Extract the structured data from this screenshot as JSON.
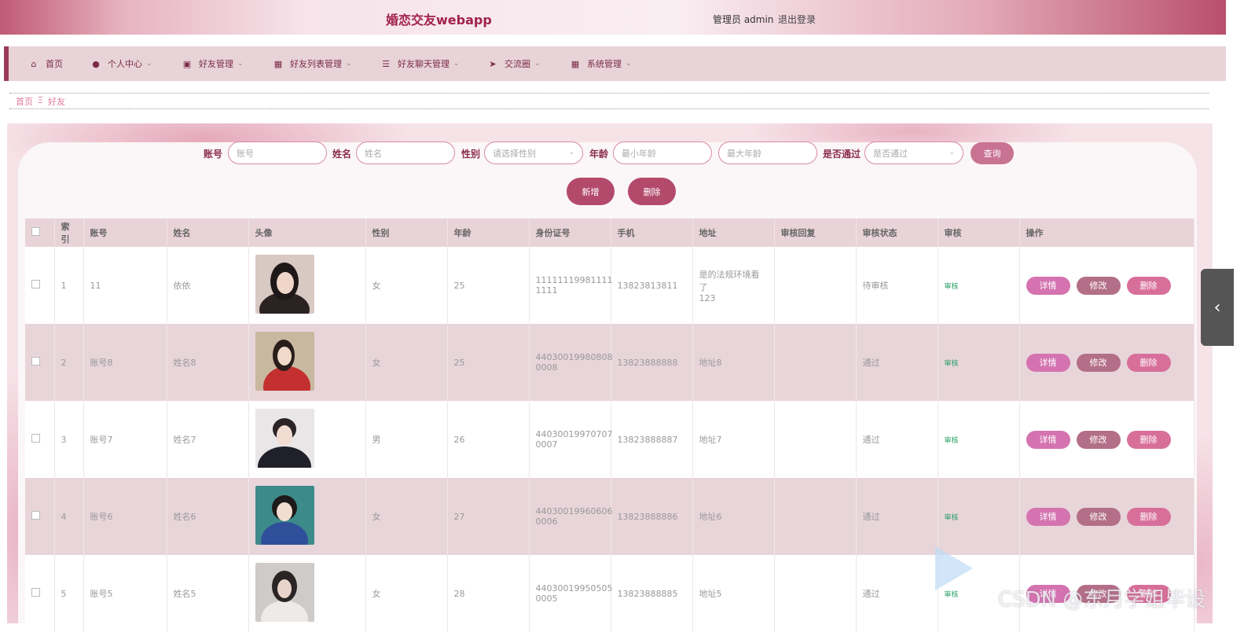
{
  "header": {
    "title": "婚恋交友webapp",
    "user": "管理员 admin",
    "logout": "退出登录"
  },
  "nav": [
    {
      "label": "首页",
      "icon": "home-icon",
      "dropdown": false
    },
    {
      "label": "个人中心",
      "icon": "user-icon",
      "dropdown": true
    },
    {
      "label": "好友管理",
      "icon": "clipboard-icon",
      "dropdown": true
    },
    {
      "label": "好友列表管理",
      "icon": "grid-icon",
      "dropdown": true
    },
    {
      "label": "好友聊天管理",
      "icon": "sliders-icon",
      "dropdown": true
    },
    {
      "label": "交流圈",
      "icon": "send-icon",
      "dropdown": true
    },
    {
      "label": "系统管理",
      "icon": "grid-icon",
      "dropdown": true
    }
  ],
  "breadcrumb": {
    "home": "首页",
    "sep": "Ξ",
    "current": "好友"
  },
  "search": {
    "account_label": "账号",
    "account_placeholder": "账号",
    "name_label": "姓名",
    "name_placeholder": "姓名",
    "gender_label": "性别",
    "gender_placeholder": "请选择性别",
    "age_label": "年龄",
    "age_min_placeholder": "最小年龄",
    "age_max_placeholder": "最大年龄",
    "pass_label": "是否通过",
    "pass_placeholder": "是否通过",
    "query": "查询"
  },
  "actions": {
    "add": "新增",
    "delete": "删除"
  },
  "table": {
    "headers": [
      "索引",
      "账号",
      "姓名",
      "头像",
      "性别",
      "年龄",
      "身份证号",
      "手机",
      "地址",
      "审核回复",
      "审核状态",
      "审核",
      "操作"
    ],
    "rows": [
      {
        "index": "1",
        "account": "11",
        "name": "依依",
        "gender": "女",
        "age": "25",
        "id_line1": "11111119981111",
        "id_line2": "1111",
        "phone": "13823813811",
        "addr_line1": "是的法规环境看了",
        "addr_line2": "123",
        "reply": "",
        "status": "待审核",
        "audit": "审核"
      },
      {
        "index": "2",
        "account": "账号8",
        "name": "姓名8",
        "gender": "女",
        "age": "25",
        "id_line1": "44030019980808",
        "id_line2": "0008",
        "phone": "13823888888",
        "addr_line1": "地址8",
        "addr_line2": "",
        "reply": "",
        "status": "通过",
        "audit": "审核"
      },
      {
        "index": "3",
        "account": "账号7",
        "name": "姓名7",
        "gender": "男",
        "age": "26",
        "id_line1": "44030019970707",
        "id_line2": "0007",
        "phone": "13823888887",
        "addr_line1": "地址7",
        "addr_line2": "",
        "reply": "",
        "status": "通过",
        "audit": "审核"
      },
      {
        "index": "4",
        "account": "账号6",
        "name": "姓名6",
        "gender": "女",
        "age": "27",
        "id_line1": "44030019960606",
        "id_line2": "0006",
        "phone": "13823888886",
        "addr_line1": "地址6",
        "addr_line2": "",
        "reply": "",
        "status": "通过",
        "audit": "审核"
      },
      {
        "index": "5",
        "account": "账号5",
        "name": "姓名5",
        "gender": "女",
        "age": "28",
        "id_line1": "44030019950505",
        "id_line2": "0005",
        "phone": "13823888885",
        "addr_line1": "地址5",
        "addr_line2": "",
        "reply": "",
        "status": "通过",
        "audit": "审核"
      }
    ],
    "ops": {
      "detail": "详情",
      "edit": "修改",
      "delete": "删除"
    }
  },
  "watermark": "CSDN @东月学姐毕设",
  "colors": {
    "accent": "#b34a6c",
    "nav_bg": "#e8d3d8",
    "audit_link": "#2aa06a"
  }
}
